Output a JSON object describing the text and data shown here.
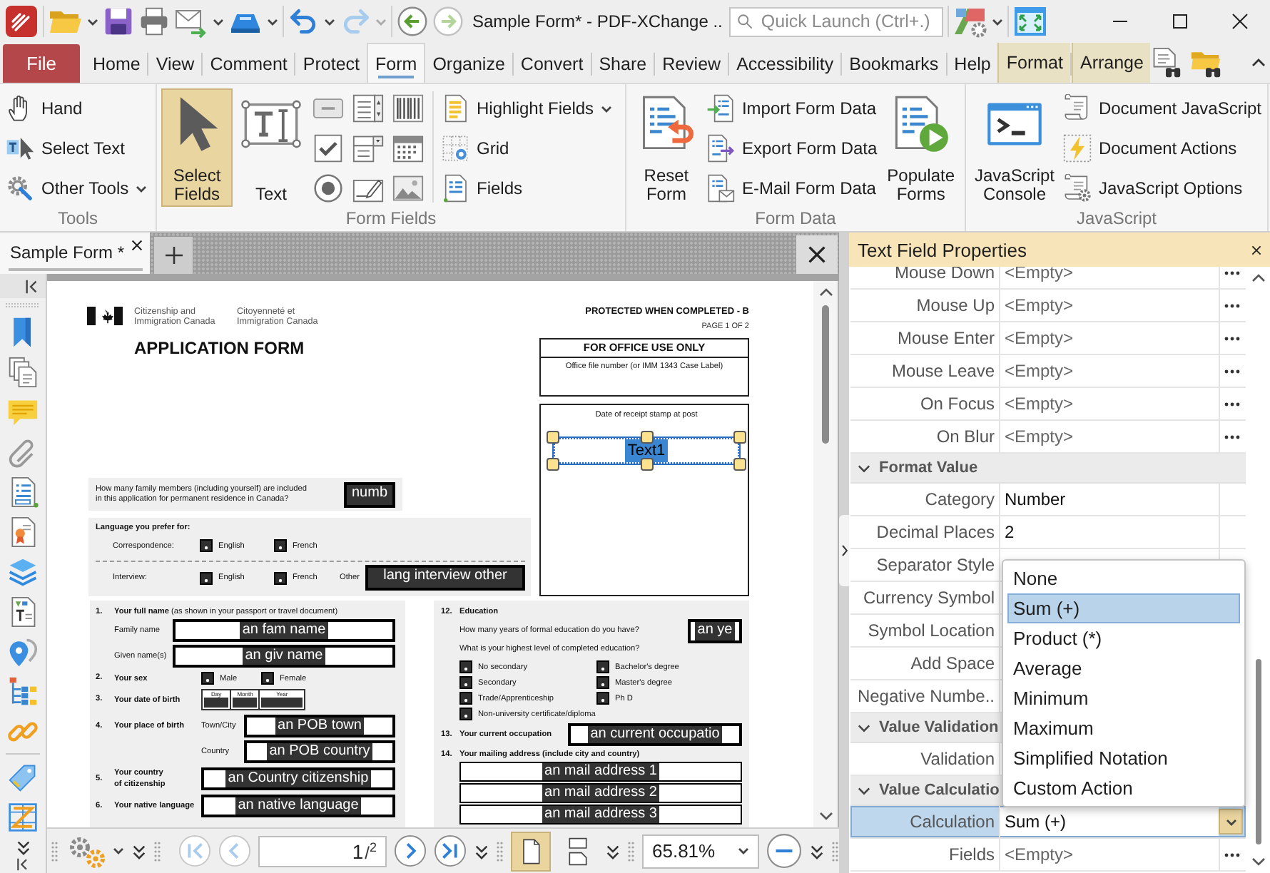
{
  "title_bar": {
    "title": "Sample Form* - PDF-XChange ..",
    "history_buttons": [
      {
        "disabled": false
      },
      {
        "disabled": true
      },
      {
        "disabled": false
      },
      {
        "disabled": true
      }
    ],
    "quick_launch": {
      "placeholder": "Quick Launch (Ctrl+.)"
    }
  },
  "ribbon_tabs": [
    {
      "label": "File",
      "kind": "file",
      "selected": false
    },
    {
      "label": "Home",
      "kind": "tab",
      "selected": false
    },
    {
      "label": "View",
      "kind": "tab",
      "selected": false
    },
    {
      "label": "Comment",
      "kind": "tab",
      "selected": false
    },
    {
      "label": "Protect",
      "kind": "tab",
      "selected": false
    },
    {
      "label": "Form",
      "kind": "tab",
      "selected": true
    },
    {
      "label": "Organize",
      "kind": "tab",
      "selected": false
    },
    {
      "label": "Convert",
      "kind": "tab",
      "selected": false
    },
    {
      "label": "Share",
      "kind": "tab",
      "selected": false
    },
    {
      "label": "Review",
      "kind": "tab",
      "selected": false
    },
    {
      "label": "Accessibility",
      "kind": "tab",
      "selected": false
    },
    {
      "label": "Bookmarks",
      "kind": "tab",
      "selected": false
    },
    {
      "label": "Help",
      "kind": "tab",
      "selected": false
    },
    {
      "label": "Format",
      "kind": "contextual",
      "selected": false
    },
    {
      "label": "Arrange",
      "kind": "contextual",
      "selected": false
    }
  ],
  "ribbon_groups": [
    {
      "label": "Tools",
      "columns": [
        {
          "kind": "small",
          "items": [
            {
              "label": "Hand"
            },
            {
              "label": "Select Text"
            },
            {
              "label": "Other Tools",
              "dropdown": true
            }
          ]
        }
      ]
    },
    {
      "label": "Form Fields",
      "columns": [
        {
          "kind": "large",
          "items": [
            {
              "label": "Select Fields",
              "selected": true
            }
          ]
        },
        {
          "kind": "large",
          "items": [
            {
              "label": "Text",
              "selected": false
            }
          ]
        },
        {
          "kind": "icon_grid"
        },
        {
          "kind": "small",
          "items": [
            {
              "label": "Highlight Fields",
              "dropdown": true
            },
            {
              "label": "Grid"
            },
            {
              "label": "Fields"
            }
          ]
        }
      ]
    },
    {
      "label": "Form Data",
      "columns": [
        {
          "kind": "large",
          "items": [
            {
              "label": "Reset Form",
              "selected": false
            }
          ]
        },
        {
          "kind": "small",
          "items": [
            {
              "label": "Import Form Data"
            },
            {
              "label": "Export Form Data"
            },
            {
              "label": "E-Mail Form Data"
            }
          ]
        },
        {
          "kind": "large",
          "items": [
            {
              "label": "Populate Forms",
              "selected": false
            }
          ]
        }
      ]
    },
    {
      "label": "JavaScript",
      "columns": [
        {
          "kind": "large",
          "items": [
            {
              "label": "JavaScript Console",
              "selected": false
            }
          ]
        },
        {
          "kind": "small",
          "items": [
            {
              "label": "Document JavaScript"
            },
            {
              "label": "Document Actions"
            },
            {
              "label": "JavaScript Options"
            }
          ]
        }
      ]
    }
  ],
  "document_tabs": [
    {
      "label": "Sample Form *",
      "selected": true
    }
  ],
  "page": {
    "agency": [
      "Citizenship and\nImmigration Canada",
      "Citoyenneté et\nImmigration Canada"
    ],
    "title": "APPLICATION FORM",
    "protection": "PROTECTED WHEN COMPLETED - B",
    "page_number": "PAGE 1 OF 2",
    "office_box": {
      "heading": "FOR OFFICE USE ONLY",
      "label": "Office file number (or IMM 1343 Case Label)"
    },
    "stamp_box": {
      "label": "Date of receipt stamp at post",
      "field": {
        "value": "Text1",
        "selected": true
      }
    },
    "family_question": {
      "text": "How many family members (including yourself) are included\nin this application for permanent residence in Canada?",
      "field": "numb"
    },
    "language": {
      "heading": "Language you prefer for:",
      "rows": [
        {
          "label": "Correspondence:",
          "options": [
            "English",
            "French"
          ]
        },
        {
          "label": "Interview:",
          "options": [
            "English",
            "French"
          ],
          "other_label": "Other",
          "other_field": "lang interview other"
        }
      ]
    },
    "left_section": [
      {
        "number": "1.",
        "kind": "stacked",
        "label": "**Your full name** (as shown in your passport or travel document)",
        "fields": [
          {
            "label": "Family name",
            "value": "an fam name"
          },
          {
            "label": "Given name(s)",
            "value": "an giv name"
          }
        ]
      },
      {
        "number": "2.",
        "kind": "options",
        "label": "Your sex",
        "options": [
          "Male",
          "Female"
        ]
      },
      {
        "number": "3.",
        "kind": "date",
        "label": "Your date of birth",
        "parts": [
          "Day",
          "Month",
          "Year"
        ]
      },
      {
        "number": "4.",
        "kind": "fields",
        "label": "Your place of birth",
        "fields": [
          {
            "label": "Town/City",
            "value": "an POB town"
          },
          {
            "label": "Country",
            "value": "an POB country"
          }
        ]
      },
      {
        "number": "5.",
        "kind": "fields",
        "label": "Your country\nof citizenship",
        "fields": [
          {
            "value": "an Country citizenship"
          }
        ]
      },
      {
        "number": "6.",
        "kind": "fields",
        "label": "Your native language",
        "fields": [
          {
            "value": "an native language"
          }
        ]
      }
    ],
    "right_section": [
      {
        "number": "12.",
        "kind": "education",
        "label": "Education",
        "question": "How many years of formal education do you have?",
        "field": "an ye",
        "question_2": "What is your highest level of completed education?",
        "option_columns": [
          [
            "No secondary",
            "Secondary",
            "Trade/Apprenticeship",
            "Non-university certificate/diploma"
          ],
          [
            "Bachelor's degree",
            "Master's degree",
            "Ph D"
          ]
        ]
      },
      {
        "number": "13.",
        "kind": "fields",
        "label": "Your current occupation",
        "fields": [
          {
            "value": "an current occupatio"
          }
        ]
      },
      {
        "number": "14.",
        "kind": "stacked",
        "label": "Your mailing address (include city and country)",
        "fields": [
          {
            "value": "an mail address 1"
          },
          {
            "value": "an mail address 2"
          },
          {
            "value": "an mail address 3"
          }
        ]
      }
    ]
  },
  "bottom_toolbar": {
    "nav_buttons": [
      {
        "disabled": true
      },
      {
        "disabled": true
      },
      {
        "disabled": false
      },
      {
        "disabled": false
      }
    ],
    "page": "1",
    "page_count": "/$^{2}$",
    "view_buttons": [
      {
        "selected": true
      },
      {
        "selected": false
      }
    ],
    "zoom": "65.81%"
  },
  "properties_panel": {
    "title": "Text Field Properties",
    "rows": [
      {
        "kind": "property",
        "label": "Mouse Down",
        "placeholder": "<Empty>",
        "action_button": true,
        "selected": false
      },
      {
        "kind": "property",
        "label": "Mouse Up",
        "placeholder": "<Empty>",
        "action_button": true,
        "selected": false
      },
      {
        "kind": "property",
        "label": "Mouse Enter",
        "placeholder": "<Empty>",
        "action_button": true,
        "selected": false
      },
      {
        "kind": "property",
        "label": "Mouse Leave",
        "placeholder": "<Empty>",
        "action_button": true,
        "selected": false
      },
      {
        "kind": "property",
        "label": "On Focus",
        "placeholder": "<Empty>",
        "action_button": true,
        "selected": false
      },
      {
        "kind": "property",
        "label": "On Blur",
        "placeholder": "<Empty>",
        "action_button": true,
        "selected": false
      },
      {
        "kind": "section",
        "label": "Format Value",
        "expanded": true
      },
      {
        "kind": "property",
        "label": "Category",
        "value": "Number",
        "selected": false
      },
      {
        "kind": "property",
        "label": "Decimal Places",
        "value": "2",
        "selected": false
      },
      {
        "kind": "property",
        "label": "Separator Style",
        "selected": false
      },
      {
        "kind": "property",
        "label": "Currency Symbol",
        "selected": false
      },
      {
        "kind": "property",
        "label": "Symbol Location",
        "selected": false
      },
      {
        "kind": "property",
        "label": "Add Space",
        "selected": false
      },
      {
        "kind": "property",
        "label": "Negative Numbe..",
        "selected": false
      },
      {
        "kind": "section",
        "label": "Value Validation",
        "expanded": true
      },
      {
        "kind": "property",
        "label": "Validation",
        "selected": false
      },
      {
        "kind": "section",
        "label": "Value Calculatio",
        "expanded": true
      },
      {
        "kind": "combo",
        "label": "Calculation",
        "value": "Sum (+)",
        "selected": true
      },
      {
        "kind": "property",
        "label": "Fields",
        "placeholder": "<Empty>",
        "action_button": true,
        "selected": false
      }
    ],
    "dropdown": {
      "options": [
        {
          "label": "None",
          "selected": false
        },
        {
          "label": "Sum (+)",
          "selected": true
        },
        {
          "label": "Product (*)",
          "selected": false
        },
        {
          "label": "Average",
          "selected": false
        },
        {
          "label": "Minimum",
          "selected": false
        },
        {
          "label": "Maximum",
          "selected": false
        },
        {
          "label": "Simplified Notation",
          "selected": false
        },
        {
          "label": "Custom Action",
          "selected": false
        }
      ]
    }
  }
}
